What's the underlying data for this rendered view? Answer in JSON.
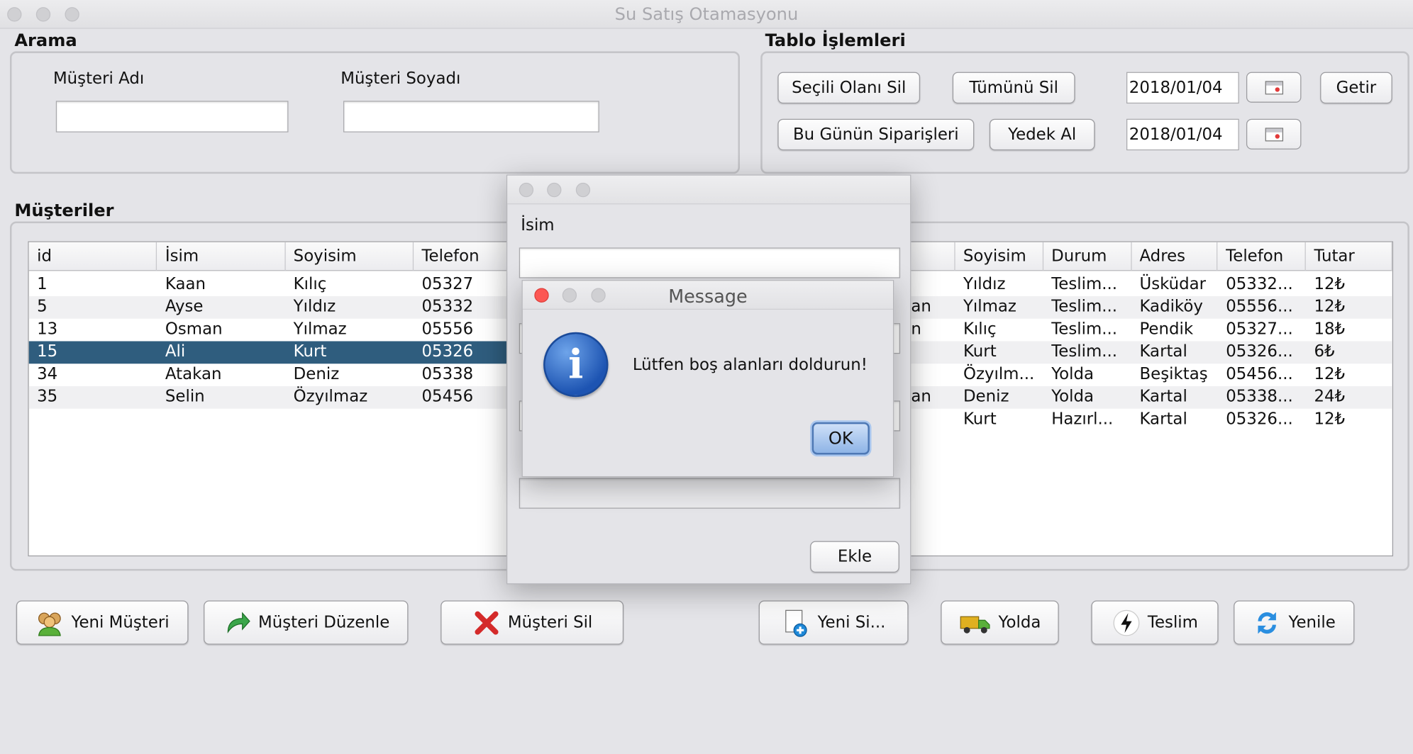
{
  "window": {
    "title": "Su Satış Otamasyonu"
  },
  "search": {
    "title": "Arama",
    "first_name_label": "Müşteri Adı",
    "last_name_label": "Müşteri Soyadı",
    "first_name_value": "",
    "last_name_value": ""
  },
  "table_ops": {
    "title": "Tablo İşlemleri",
    "delete_selected": "Seçili Olanı Sil",
    "delete_all": "Tümünü Sil",
    "date1": "2018/01/04",
    "fetch": "Getir",
    "todays_orders": "Bu Günün Siparişleri",
    "backup": "Yedek Al",
    "date2": "2018/01/04"
  },
  "customers": {
    "title": "Müşteriler",
    "columns": [
      "id",
      "İsim",
      "Soyisim",
      "Telefon"
    ],
    "rows": [
      {
        "id": "1",
        "name": "Kaan",
        "surname": "Kılıç",
        "phone": "05327"
      },
      {
        "id": "5",
        "name": "Ayse",
        "surname": "Yıldız",
        "phone": "05332"
      },
      {
        "id": "13",
        "name": "Osman",
        "surname": "Yılmaz",
        "phone": "05556"
      },
      {
        "id": "15",
        "name": "Ali",
        "surname": "Kurt",
        "phone": "05326"
      },
      {
        "id": "34",
        "name": "Atakan",
        "surname": "Deniz",
        "phone": "05338"
      },
      {
        "id": "35",
        "name": "Selin",
        "surname": "Özyılmaz",
        "phone": "05456"
      }
    ],
    "selected_row": 3
  },
  "orders": {
    "columns": [
      "Soyisim",
      "Durum",
      "Adres",
      "Telefon",
      "Tutar"
    ],
    "rows": [
      {
        "left": "",
        "surname": "Yıldız",
        "status": "Teslim...",
        "address": "Üsküdar",
        "phone": "05332...",
        "amount": "12₺"
      },
      {
        "left": "an",
        "surname": "Yılmaz",
        "status": "Teslim...",
        "address": "Kadiköy",
        "phone": "05556...",
        "amount": "12₺"
      },
      {
        "left": "n",
        "surname": "Kılıç",
        "status": "Teslim...",
        "address": "Pendik",
        "phone": "05327...",
        "amount": "18₺"
      },
      {
        "left": "",
        "surname": "Kurt",
        "status": "Teslim...",
        "address": "Kartal",
        "phone": "05326...",
        "amount": "6₺"
      },
      {
        "left": "",
        "surname": "Özyılm...",
        "status": "Yolda",
        "address": "Beşiktaş",
        "phone": "05456...",
        "amount": "12₺"
      },
      {
        "left": "an",
        "surname": "Deniz",
        "status": "Yolda",
        "address": "Kartal",
        "phone": "05338...",
        "amount": "24₺"
      },
      {
        "left": "",
        "surname": "Kurt",
        "status": "Hazırl...",
        "address": "Kartal",
        "phone": "05326...",
        "amount": "12₺"
      }
    ]
  },
  "bottom_buttons": {
    "new_customer": "Yeni Müşteri",
    "edit_customer": "Müşteri Düzenle",
    "delete_customer": "Müşteri Sil",
    "new_order": "Yeni Si...",
    "on_the_way": "Yolda",
    "delivered": "Teslim",
    "refresh": "Yenile"
  },
  "add_dialog": {
    "name_label": "İsim",
    "name_value": "",
    "add_button": "Ekle"
  },
  "message_dialog": {
    "title": "Message",
    "text": "Lütfen boş alanları doldurun!",
    "ok": "OK"
  },
  "colors": {
    "selection": "#2f5d7e",
    "background": "#e4e4e8",
    "close_red": "#fc5753"
  },
  "icons": [
    "users-icon",
    "redo-arrow-icon",
    "red-x-icon",
    "new-document-icon",
    "truck-icon",
    "bolt-icon",
    "refresh-icon",
    "calendar-icon",
    "info-icon"
  ]
}
